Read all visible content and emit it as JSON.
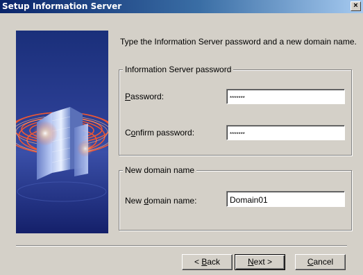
{
  "window": {
    "title": "Setup Information Server",
    "close_label": "×"
  },
  "intro_text": "Type the Information Server password and a new domain name.",
  "password_group": {
    "legend": "Information Server password",
    "password_label_pre": "",
    "password_label_key": "P",
    "password_label_post": "assword:",
    "password_value": "*******",
    "confirm_label_pre": "C",
    "confirm_label_key": "o",
    "confirm_label_post": "nfirm password:",
    "confirm_value": "*******"
  },
  "domain_group": {
    "legend": "New domain name",
    "label_pre": "New ",
    "label_key": "d",
    "label_post": "omain name:",
    "value": "Domain01"
  },
  "buttons": {
    "back_pre": "< ",
    "back_key": "B",
    "back_post": "ack",
    "next_key": "N",
    "next_post": "ext >",
    "cancel_key": "C",
    "cancel_post": "ancel"
  },
  "colors": {
    "title_start": "#0a246a",
    "title_end": "#a6caf0",
    "face": "#d4d0c8"
  }
}
